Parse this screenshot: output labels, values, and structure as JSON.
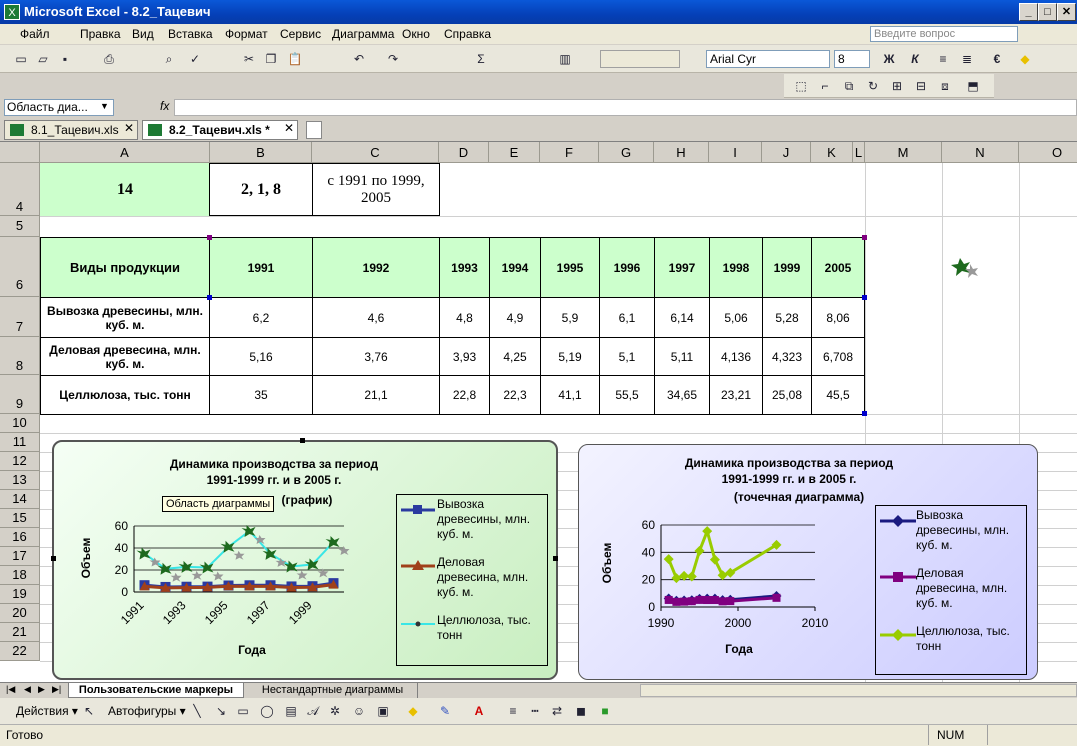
{
  "window": {
    "title": "Microsoft Excel - 8.2_Тацевич",
    "app_icon": "X"
  },
  "menu": [
    "Файл",
    "Правка",
    "Вид",
    "Вставка",
    "Формат",
    "Сервис",
    "Диаграмма",
    "Окно",
    "Справка"
  ],
  "help_placeholder": "Введите вопрос",
  "font": {
    "name": "Arial Cyr",
    "size": "8"
  },
  "format_buttons": {
    "bold": "Ж",
    "italic": "К",
    "euro": "€"
  },
  "namebox": "Область диа...",
  "fx": "fx",
  "workbook_tabs": [
    "8.1_Тацевич.xls",
    "8.2_Тацевич.xls *"
  ],
  "columns": [
    "A",
    "B",
    "C",
    "D",
    "E",
    "F",
    "G",
    "H",
    "I",
    "J",
    "K",
    "L",
    "M",
    "N",
    "O"
  ],
  "rows": [
    "4",
    "5",
    "6",
    "7",
    "8",
    "9",
    "10",
    "11",
    "12",
    "13",
    "14",
    "15",
    "16",
    "17",
    "18",
    "19",
    "20",
    "21",
    "22"
  ],
  "row4": {
    "a": "14",
    "b": "2, 1, 8",
    "c": "с 1991  по 1999, 2005"
  },
  "table": {
    "header_label": "Виды продукции",
    "years": [
      "1991",
      "1992",
      "1993",
      "1994",
      "1995",
      "1996",
      "1997",
      "1998",
      "1999",
      "2005"
    ],
    "rows": [
      {
        "label": "Вывозка древесины, млн. куб. м.",
        "values": [
          "6,2",
          "4,6",
          "4,8",
          "4,9",
          "5,9",
          "6,1",
          "6,14",
          "5,06",
          "5,28",
          "8,06"
        ]
      },
      {
        "label": "Деловая древесина, млн. куб. м.",
        "values": [
          "5,16",
          "3,76",
          "3,93",
          "4,25",
          "5,19",
          "5,1",
          "5,11",
          "4,136",
          "4,323",
          "6,708"
        ]
      },
      {
        "label": "Целлюлоза, тыс. тонн",
        "values": [
          "35",
          "21,1",
          "22,8",
          "22,3",
          "41,1",
          "55,5",
          "34,65",
          "23,21",
          "25,08",
          "45,5"
        ]
      }
    ]
  },
  "tooltip": "Область диаграммы",
  "chart_data": [
    {
      "type": "line",
      "title": "Динамика производства за период 1991-1999 гг. и в 2005 г.",
      "title_suffix": "(график)",
      "ylabel": "Объем",
      "xlabel": "Года",
      "ylim": [
        0,
        60
      ],
      "yticks": [
        "0",
        "20",
        "40",
        "60"
      ],
      "categories": [
        "1991",
        "1992",
        "1993",
        "1994",
        "1995",
        "1996",
        "1997",
        "1998",
        "1999",
        "2005"
      ],
      "xtick_labels": [
        "1991",
        "1993",
        "1995",
        "1997",
        "1999"
      ],
      "series": [
        {
          "name": "Вывозка древесины, млн. куб. м.",
          "values": [
            6.2,
            4.6,
            4.8,
            4.9,
            5.9,
            6.1,
            6.14,
            5.06,
            5.28,
            8.06
          ],
          "color": "#2b3aa0"
        },
        {
          "name": "Деловая древесина, млн. куб. м.",
          "values": [
            5.16,
            3.76,
            3.93,
            4.25,
            5.19,
            5.1,
            5.11,
            4.136,
            4.323,
            6.708
          ],
          "color": "#a0401a"
        },
        {
          "name": "Целлюлоза, тыс. тонн",
          "values": [
            35,
            21.1,
            22.8,
            22.3,
            41.1,
            55.5,
            34.65,
            23.21,
            25.08,
            45.5
          ],
          "color": "#39e6e6"
        }
      ]
    },
    {
      "type": "scatter",
      "title": "Динамика производства за период 1991-1999 гг. и в 2005 г.",
      "title_suffix": "(точечная диаграмма)",
      "ylabel": "Объем",
      "xlabel": "Года",
      "xlim": [
        1990,
        2010
      ],
      "ylim": [
        0,
        60
      ],
      "yticks": [
        "0",
        "20",
        "40",
        "60"
      ],
      "xticks": [
        "1990",
        "2000",
        "2010"
      ],
      "x": [
        1991,
        1992,
        1993,
        1994,
        1995,
        1996,
        1997,
        1998,
        1999,
        2005
      ],
      "series": [
        {
          "name": "Вывозка древесины, млн. куб. м.",
          "values": [
            6.2,
            4.6,
            4.8,
            4.9,
            5.9,
            6.1,
            6.14,
            5.06,
            5.28,
            8.06
          ],
          "color": "#1a1a80"
        },
        {
          "name": "Деловая древесина, млн. куб. м.",
          "values": [
            5.16,
            3.76,
            3.93,
            4.25,
            5.19,
            5.1,
            5.11,
            4.136,
            4.323,
            6.708
          ],
          "color": "#800080"
        },
        {
          "name": "Целлюлоза, тыс. тонн",
          "values": [
            35,
            21.1,
            22.8,
            22.3,
            41.1,
            55.5,
            34.65,
            23.21,
            25.08,
            45.5
          ],
          "color": "#99cc00"
        }
      ]
    }
  ],
  "sheet_tabs": [
    "Пользовательские маркеры",
    "Нестандартные диаграммы"
  ],
  "draw_toolbar": {
    "actions": "Действия",
    "autoshapes": "Автофигуры"
  },
  "status": {
    "ready": "Готово",
    "num": "NUM"
  }
}
